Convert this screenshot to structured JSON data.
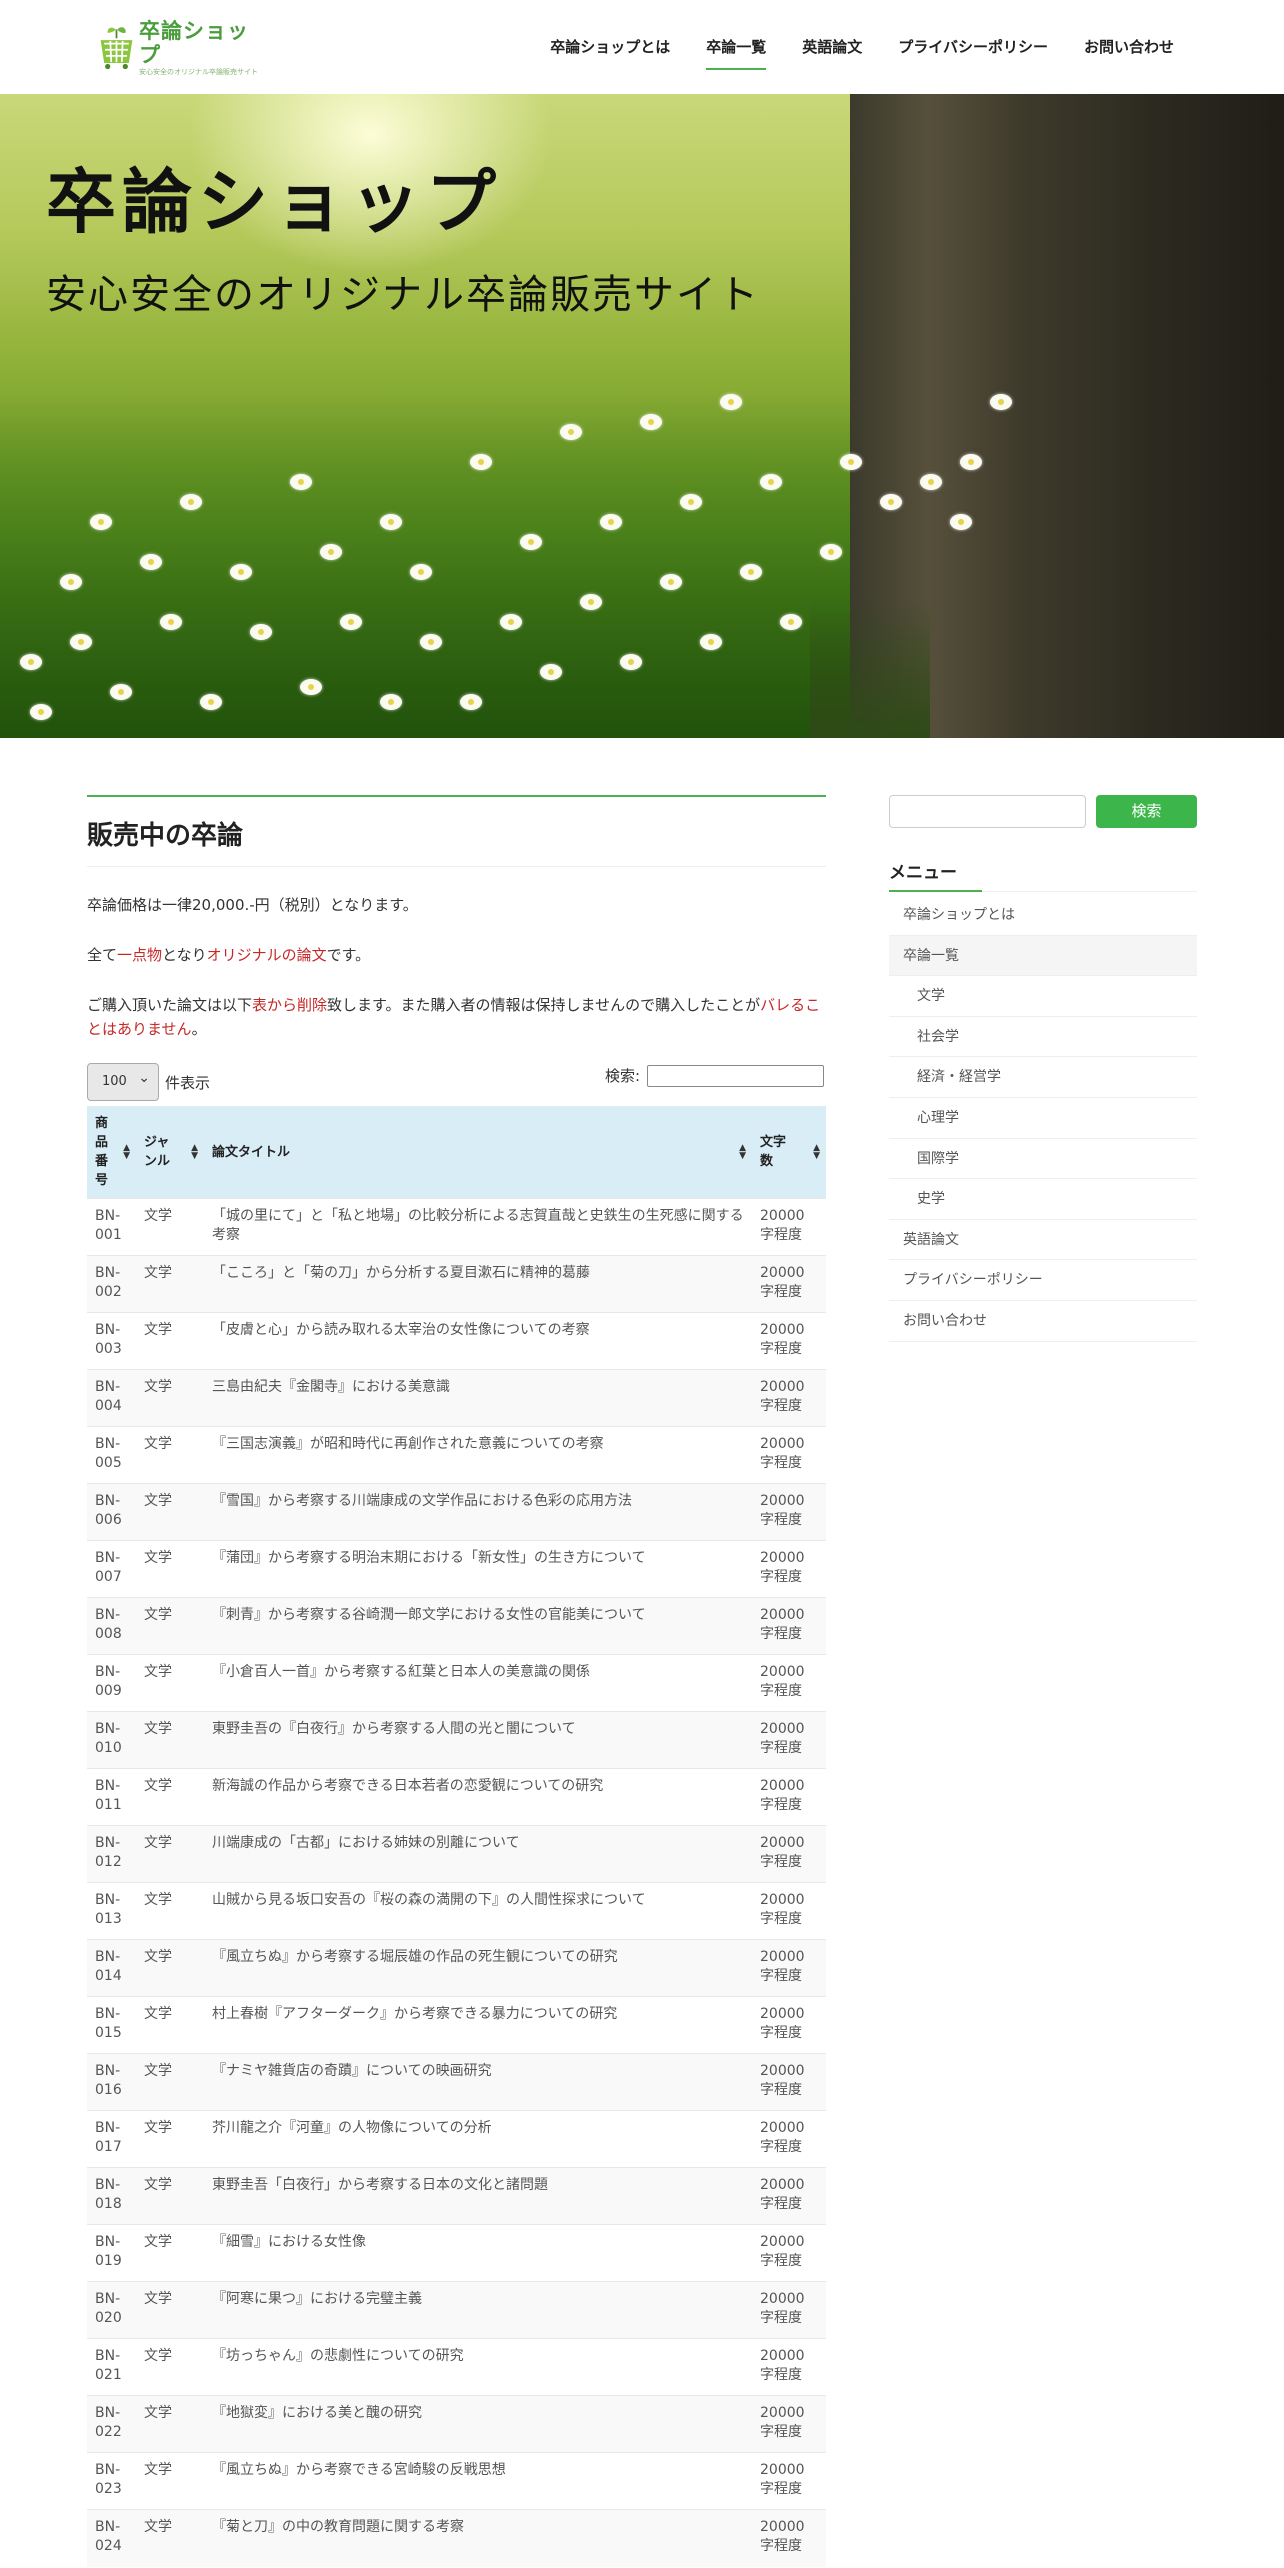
{
  "header": {
    "logo_title": "卒論ショップ",
    "logo_sub": "安心安全のオリジナル卒論販売サイト",
    "nav": [
      "卒論ショップとは",
      "卒論一覧",
      "英語論文",
      "プライバシーポリシー",
      "お問い合わせ"
    ],
    "active_nav": "卒論一覧"
  },
  "hero": {
    "title": "卒論ショップ",
    "subtitle": "安心安全のオリジナル卒論販売サイト"
  },
  "main": {
    "page_title": "販売中の卒論",
    "p1": "卒論価格は一律20,000.-円（税別）となります。",
    "p2": [
      {
        "t": "全て",
        "red": false
      },
      {
        "t": "一点物",
        "red": true
      },
      {
        "t": "となり",
        "red": false
      },
      {
        "t": "オリジナルの論文",
        "red": true
      },
      {
        "t": "です。",
        "red": false
      }
    ],
    "p3": [
      {
        "t": "ご購入頂いた論文は以下",
        "red": false
      },
      {
        "t": "表から削除",
        "red": true
      },
      {
        "t": "致します。また購入者の情報は保持しませんので購入したことが",
        "red": false
      },
      {
        "t": "バレることはありません",
        "red": true
      },
      {
        "t": "。",
        "red": false
      }
    ],
    "length_value": "100",
    "length_label": "件表示",
    "search_label": "検索:"
  },
  "table": {
    "headers": [
      "商品番号",
      "ジャンル",
      "論文タイトル",
      "文字数"
    ],
    "rows": [
      [
        "BN-001",
        "文学",
        "「城の里にて」と「私と地場」の比較分析による志賀直哉と史鉄生の生死感に関する考察",
        "20000字程度"
      ],
      [
        "BN-002",
        "文学",
        "「こころ」と「菊の刀」から分析する夏目漱石に精神的葛藤",
        "20000字程度"
      ],
      [
        "BN-003",
        "文学",
        "「皮膚と心」から読み取れる太宰治の女性像についての考察",
        "20000字程度"
      ],
      [
        "BN-004",
        "文学",
        "三島由紀夫『金閣寺』における美意識",
        "20000字程度"
      ],
      [
        "BN-005",
        "文学",
        "『三国志演義』が昭和時代に再創作された意義についての考察",
        "20000字程度"
      ],
      [
        "BN-006",
        "文学",
        "『雪国』から考察する川端康成の文学作品における色彩の応用方法",
        "20000字程度"
      ],
      [
        "BN-007",
        "文学",
        "『蒲団』から考察する明治末期における「新女性」の生き方について",
        "20000字程度"
      ],
      [
        "BN-008",
        "文学",
        "『刺青』から考察する谷崎潤一郎文学における女性の官能美について",
        "20000字程度"
      ],
      [
        "BN-009",
        "文学",
        "『小倉百人一首』から考察する紅葉と日本人の美意識の関係",
        "20000字程度"
      ],
      [
        "BN-010",
        "文学",
        "東野圭吾の『白夜行』から考察する人間の光と闇について",
        "20000字程度"
      ],
      [
        "BN-011",
        "文学",
        "新海誠の作品から考察できる日本若者の恋愛観についての研究",
        "20000字程度"
      ],
      [
        "BN-012",
        "文学",
        "川端康成の「古都」における姉妹の別離について",
        "20000字程度"
      ],
      [
        "BN-013",
        "文学",
        "山賊から見る坂口安吾の『桜の森の満開の下』の人間性探求について",
        "20000字程度"
      ],
      [
        "BN-014",
        "文学",
        "『風立ちぬ』から考察する堀辰雄の作品の死生観についての研究",
        "20000字程度"
      ],
      [
        "BN-015",
        "文学",
        "村上春樹『アフターダーク』から考察できる暴力についての研究",
        "20000字程度"
      ],
      [
        "BN-016",
        "文学",
        "『ナミヤ雑貨店の奇蹟』についての映画研究",
        "20000字程度"
      ],
      [
        "BN-017",
        "文学",
        "芥川龍之介『河童』の人物像についての分析",
        "20000字程度"
      ],
      [
        "BN-018",
        "文学",
        "東野圭吾「白夜行」から考察する日本の文化と諸問題",
        "20000字程度"
      ],
      [
        "BN-019",
        "文学",
        "『細雪』における女性像",
        "20000字程度"
      ],
      [
        "BN-020",
        "文学",
        "『阿寒に果つ』における完璧主義",
        "20000字程度"
      ],
      [
        "BN-021",
        "文学",
        "『坊っちゃん』の悲劇性についての研究",
        "20000字程度"
      ],
      [
        "BN-022",
        "文学",
        "『地獄変』における美と醜の研究",
        "20000字程度"
      ],
      [
        "BN-023",
        "文学",
        "『風立ちぬ』から考察できる宮崎駿の反戦思想",
        "20000字程度"
      ],
      [
        "BN-024",
        "文学",
        "『菊と刀』の中の教育問題に関する考察",
        "20000字程度"
      ]
    ]
  },
  "sidebar": {
    "search_button": "検索",
    "menu_title": "メニュー",
    "menu": [
      {
        "label": "卒論ショップとは",
        "sub": false,
        "current": false
      },
      {
        "label": "卒論一覧",
        "sub": false,
        "current": true
      },
      {
        "label": "文学",
        "sub": true,
        "current": false
      },
      {
        "label": "社会学",
        "sub": true,
        "current": false
      },
      {
        "label": "経済・経営学",
        "sub": true,
        "current": false
      },
      {
        "label": "心理学",
        "sub": true,
        "current": false
      },
      {
        "label": "国際学",
        "sub": true,
        "current": false
      },
      {
        "label": "史学",
        "sub": true,
        "current": false
      },
      {
        "label": "英語論文",
        "sub": false,
        "current": false
      },
      {
        "label": "プライバシーポリシー",
        "sub": false,
        "current": false
      },
      {
        "label": "お問い合わせ",
        "sub": false,
        "current": false
      }
    ]
  },
  "colors": {
    "accent": "#4caf50",
    "button": "#3cb64b",
    "table_header": "#d9edf7",
    "highlight": "#c62828"
  }
}
